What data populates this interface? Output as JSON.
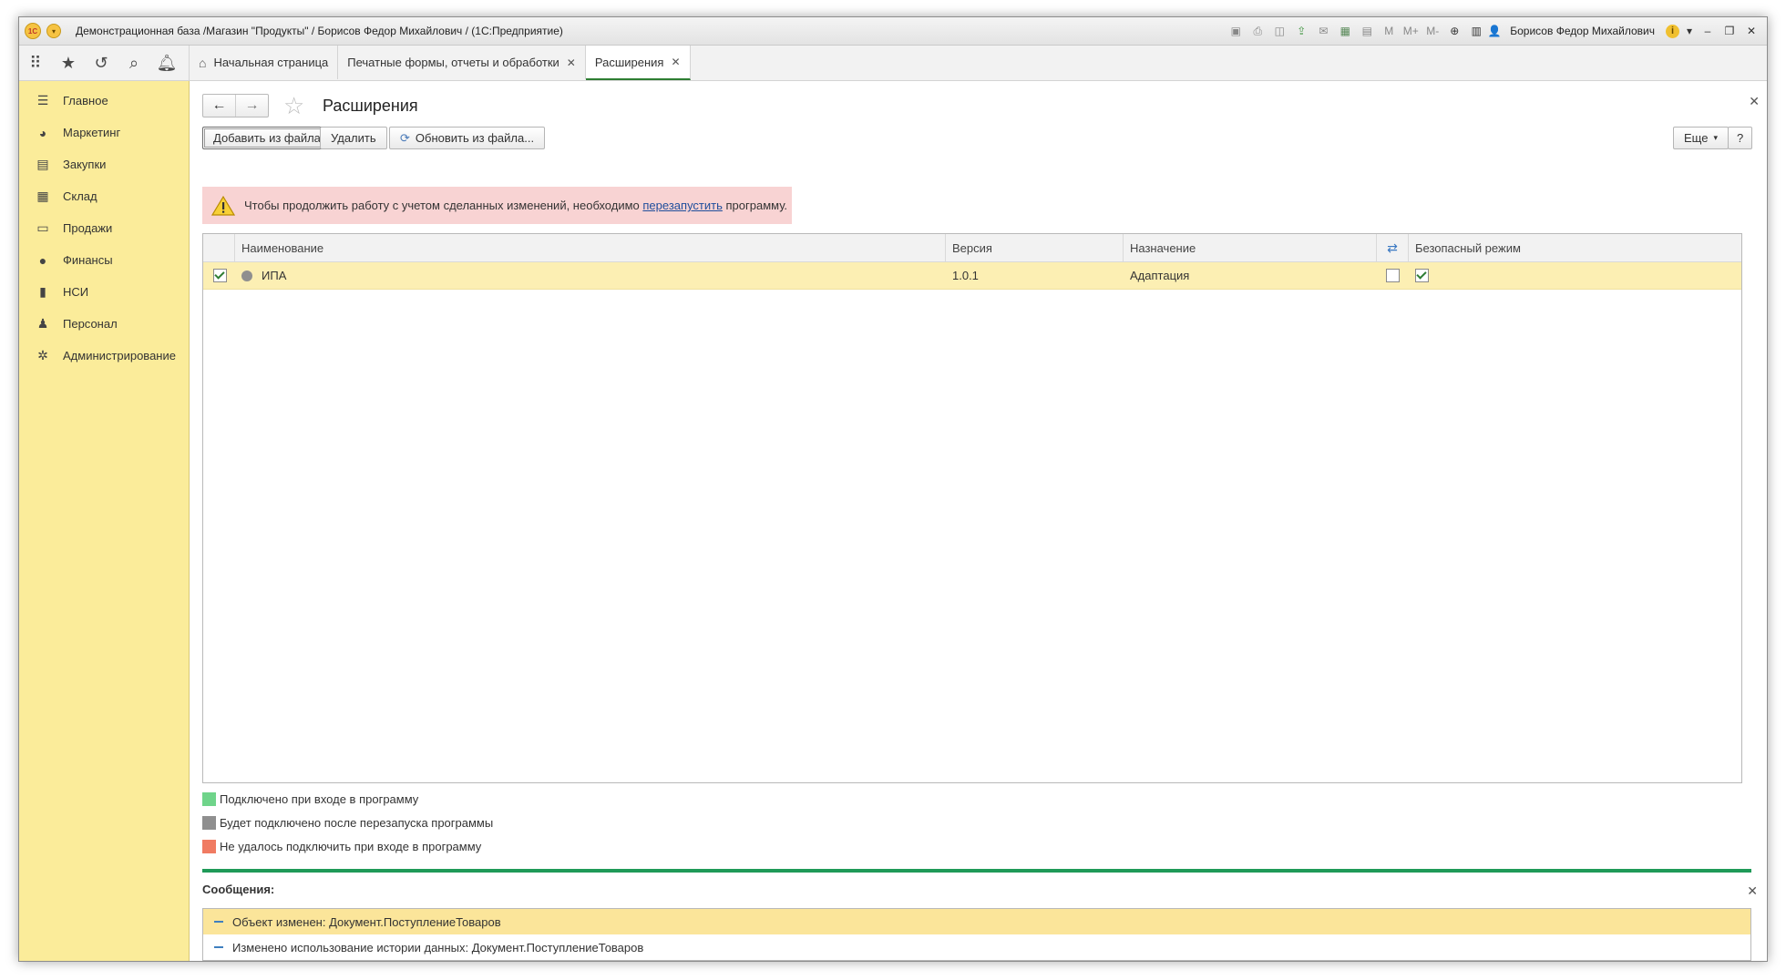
{
  "window": {
    "title": "Демонстрационная база /Магазин \"Продукты\" / Борисов Федор Михайлович / (1С:Предприятие)",
    "logo_text": "1C",
    "user": "Борисов Федор Михайлович",
    "toolbar_icons": [
      "save-icon",
      "print-icon",
      "preview-icon",
      "upload-icon",
      "mail-icon",
      "calculator-icon",
      "calendar-icon",
      "memory-m-icon",
      "memory-plus-icon",
      "memory-minus-icon",
      "zoom-icon",
      "panel-icon",
      "user-icon",
      "info-icon",
      "minimize-icon",
      "restore-icon",
      "close-icon"
    ],
    "mem_labels": {
      "m": "M",
      "mplus": "M+",
      "mminus": "M-"
    }
  },
  "quickbar": [
    "apps-grid-icon",
    "favorites-star-icon",
    "history-icon",
    "search-icon",
    "notifications-bell-icon"
  ],
  "tabs": [
    {
      "label": "Начальная страница",
      "active": false
    },
    {
      "label": "Печатные формы, отчеты и обработки",
      "active": false
    },
    {
      "label": "Расширения",
      "active": true
    }
  ],
  "sidebar": {
    "items": [
      {
        "label": "Главное",
        "icon": "menu-lines-icon"
      },
      {
        "label": "Маркетинг",
        "icon": "pie-chart-icon"
      },
      {
        "label": "Закупки",
        "icon": "cart-icon"
      },
      {
        "label": "Склад",
        "icon": "warehouse-grid-icon"
      },
      {
        "label": "Продажи",
        "icon": "basket-icon"
      },
      {
        "label": "Финансы",
        "icon": "ruble-coin-icon"
      },
      {
        "label": "НСИ",
        "icon": "books-icon"
      },
      {
        "label": "Персонал",
        "icon": "person-icon"
      },
      {
        "label": "Администрирование",
        "icon": "gear-icon"
      }
    ]
  },
  "form": {
    "title": "Расширения",
    "buttons": {
      "add_from_file": "Добавить из файла...",
      "delete": "Удалить",
      "update_from_file": "Обновить из файла...",
      "more": "Еще",
      "help": "?"
    },
    "warning": {
      "text_before": "Чтобы продолжить работу с учетом сделанных изменений, необходимо ",
      "link": "перезапустить",
      "text_after": " программу."
    },
    "table": {
      "columns": [
        "Наименование",
        "Версия",
        "Назначение",
        "",
        "Безопасный режим"
      ],
      "rows": [
        {
          "active": true,
          "name": "ИПА",
          "status": "pending-restart",
          "version": "1.0.1",
          "purpose": "Адаптация",
          "flag": false,
          "safe_mode": true
        }
      ]
    },
    "legend": [
      {
        "label": "Подключено при входе в программу",
        "color": "#6fd48a"
      },
      {
        "label": "Будет подключено после перезапуска программы",
        "color": "#8f8f8f"
      },
      {
        "label": "Не удалось подключить при входе в программу",
        "color": "#f07b62"
      }
    ]
  },
  "messages": {
    "title": "Сообщения:",
    "items": [
      {
        "text": "Объект изменен: Документ.ПоступлениеТоваров",
        "selected": true
      },
      {
        "text": "Изменено использование истории данных: Документ.ПоступлениеТоваров",
        "selected": false
      }
    ]
  },
  "colors": {
    "sidebar": "#fbec9a",
    "accent_green": "#1f9a58",
    "row_highlight": "#fcefb3",
    "warning_bg": "#f8d3d3"
  }
}
